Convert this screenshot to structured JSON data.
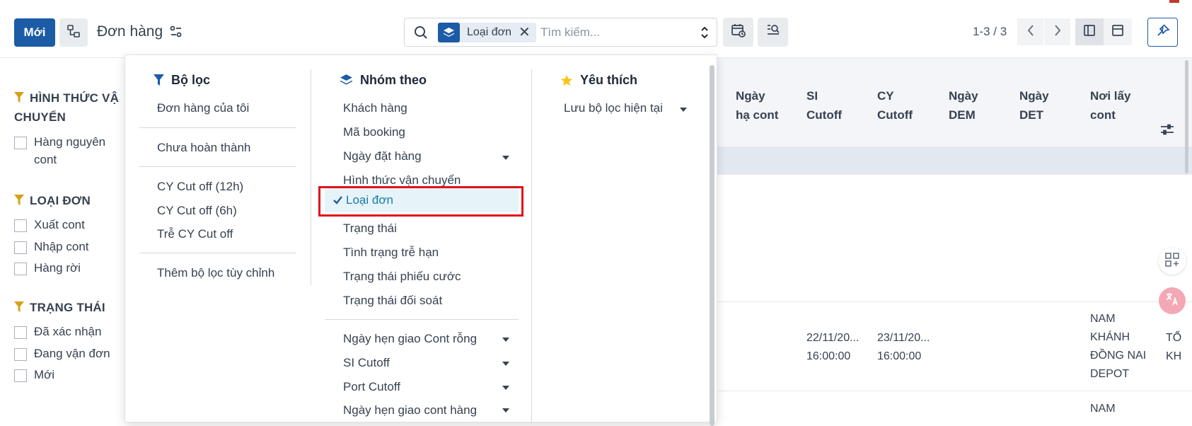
{
  "toolbar": {
    "new_label": "Mới",
    "page_title": "Đơn hàng",
    "pager_text": "1-3 / 3"
  },
  "search": {
    "facet_label": "Loại đơn",
    "placeholder": "Tìm kiếm..."
  },
  "sidebar": {
    "sections": [
      {
        "title": "HÌNH THỨC VẬN CHUYỂN",
        "title_line1": "HÌNH THỨC VẬ",
        "title_line2": "CHUYỂN",
        "items": [
          "Hàng nguyên cont"
        ]
      },
      {
        "title": "LOẠI ĐƠN",
        "items": [
          "Xuất cont",
          "Nhập cont",
          "Hàng rời"
        ]
      },
      {
        "title": "TRẠNG THÁI",
        "items": [
          "Đã xác nhận",
          "Đang vận đơn",
          "Mới"
        ]
      }
    ]
  },
  "dropdown": {
    "filters": {
      "title": "Bộ lọc",
      "items": [
        "Đơn hàng của tôi",
        "Chưa hoàn thành",
        "CY Cut off (12h)",
        "CY Cut off (6h)",
        "Trễ CY Cut off",
        "Thêm bộ lọc tùy chỉnh"
      ]
    },
    "groupby": {
      "title": "Nhóm theo",
      "items": [
        "Khách hàng",
        "Mã booking",
        "Ngày đặt hàng",
        "Hình thức vận chuyển",
        "Loại đơn",
        "Trạng thái",
        "Tình trạng trễ hạn",
        "Trạng thái phiếu cước",
        "Trạng thái đối soát",
        "Ngày hẹn giao Cont rỗng",
        "SI Cutoff",
        "Port Cutoff",
        "Ngày hẹn giao cont hàng"
      ],
      "selected": "Loại đơn"
    },
    "favorites": {
      "title": "Yêu thích",
      "items": [
        "Lưu bộ lọc hiện tại"
      ]
    }
  },
  "table": {
    "headers": [
      "Ngày hạ cont",
      "SI Cutoff",
      "CY Cutoff",
      "Ngày DEM",
      "Ngày DET",
      "Nơi lấy cont"
    ],
    "header_lines": [
      [
        "Ngày",
        "hạ cont"
      ],
      [
        "SI",
        "Cutoff"
      ],
      [
        "CY",
        "Cutoff"
      ],
      [
        "Ngày",
        "DEM"
      ],
      [
        "Ngày",
        "DET"
      ],
      [
        "Nơi lấy",
        "cont"
      ]
    ],
    "row1": {
      "ellipsis": "..",
      "si_cutoff": [
        "22/11/20...",
        "16:00:00"
      ],
      "cy_cutoff": [
        "23/11/20...",
        "16:00:00"
      ],
      "pickup": [
        "NAM",
        "KHÁNH",
        "ĐỒNG NAI",
        "DEPOT"
      ],
      "extra": [
        "TỔ",
        "KH"
      ]
    },
    "row2": {
      "pickup": [
        "NAM"
      ]
    }
  },
  "colors": {
    "primary": "#1c5ba6",
    "filter_icon": "#d4a017",
    "star": "#f5c518",
    "selected_text": "#1a7ba5",
    "highlight_box": "#e0121b"
  }
}
